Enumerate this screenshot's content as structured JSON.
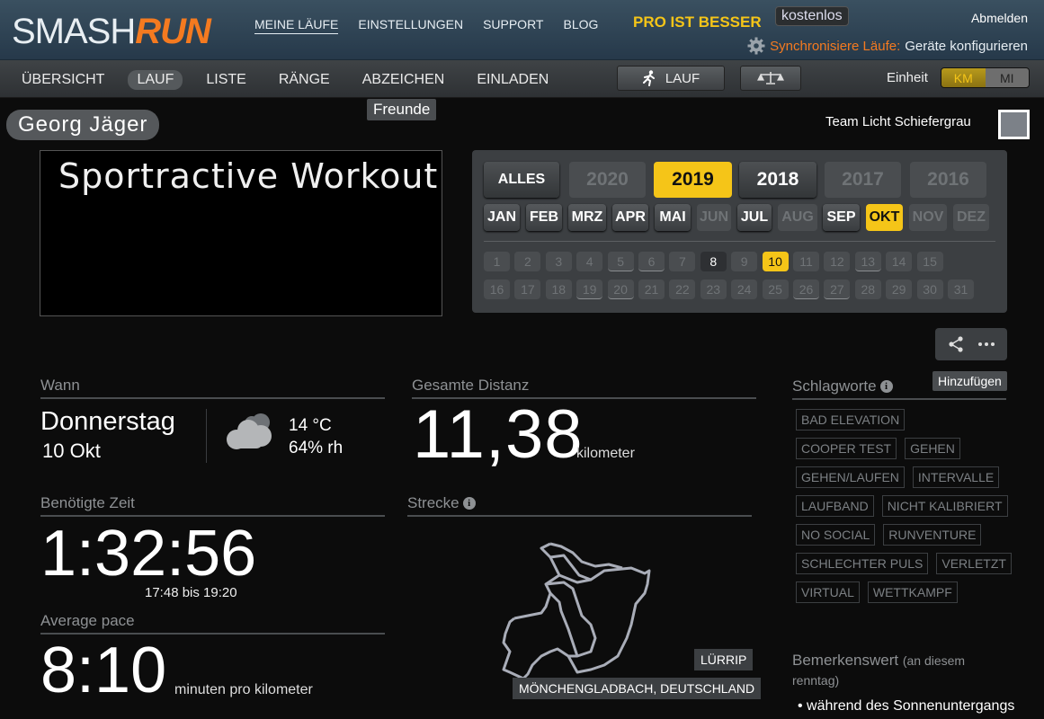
{
  "header": {
    "logo_smash": "SMASH",
    "logo_run": "RUN",
    "nav": [
      "MEINE LÄUFE",
      "EINSTELLUNGEN",
      "SUPPORT",
      "BLOG"
    ],
    "pro": "PRO IST BESSER",
    "kostenlos": "kostenlos",
    "abmelden": "Abmelden",
    "sync_label": "Synchronisiere Läufe:",
    "sync_config": "Geräte konfigurieren"
  },
  "subnav": {
    "items": [
      "ÜBERSICHT",
      "LAUF",
      "LISTE",
      "RÄNGE",
      "ABZEICHEN",
      "EINLADEN"
    ],
    "lauf_button": "LAUF",
    "einheit": "Einheit",
    "unit_km": "KM",
    "unit_mi": "MI",
    "tooltip": "Freunde"
  },
  "user": {
    "name": "Georg Jäger",
    "team": "Team Licht Schiefergrau"
  },
  "run_title": "Sportractive Workout",
  "calendar": {
    "alles": "ALLES",
    "years": [
      "2020",
      "2019",
      "2018",
      "2017",
      "2016"
    ],
    "months": [
      "JAN",
      "FEB",
      "MRZ",
      "APR",
      "MAI",
      "JUN",
      "JUL",
      "AUG",
      "SEP",
      "OKT",
      "NOV",
      "DEZ"
    ],
    "days_row1": [
      "1",
      "2",
      "3",
      "4",
      "5",
      "6",
      "7",
      "8",
      "9",
      "10",
      "11",
      "12",
      "13",
      "14",
      "15"
    ],
    "days_row2": [
      "16",
      "17",
      "18",
      "19",
      "20",
      "21",
      "22",
      "23",
      "24",
      "25",
      "26",
      "27",
      "28",
      "29",
      "30",
      "31"
    ]
  },
  "share": {
    "add_tooltip": "Hinzufügen"
  },
  "stats": {
    "when_label": "Wann",
    "day": "Donnerstag",
    "date": "10 Okt",
    "temp": "14 °C",
    "humidity": "64% rh",
    "distance_label": "Gesamte Distanz",
    "distance": "11,38",
    "distance_unit": "kilometer",
    "time_label": "Benötigte Zeit",
    "time": "1:32:56",
    "time_range": "17:48 bis 19:20",
    "route_label": "Strecke",
    "pace_label": "Average pace",
    "pace": "8:10",
    "pace_unit": "minuten pro kilometer",
    "map_tag_1": "LÜRRIP",
    "map_tag_2": "MÖNCHENGLADBACH, DEUTSCHLAND"
  },
  "tags": {
    "label": "Schlagworte",
    "items": [
      "BAD ELEVATION",
      "COOPER TEST",
      "GEHEN",
      "GEHEN/LAUFEN",
      "INTERVALLE",
      "LAUFBAND",
      "NICHT KALIBRIERT",
      "NO SOCIAL",
      "RUNVENTURE",
      "SCHLECHTER PULS",
      "VERLETZT",
      "VIRTUAL",
      "WETTKAMPF"
    ]
  },
  "notable": {
    "label": "Bemerkenswert",
    "sub": "(an diesem renntag)",
    "bullet": "• während des Sonnenuntergangs"
  },
  "colors": {
    "accent_yellow": "#f5c518",
    "brand_orange": "#f47a20"
  }
}
